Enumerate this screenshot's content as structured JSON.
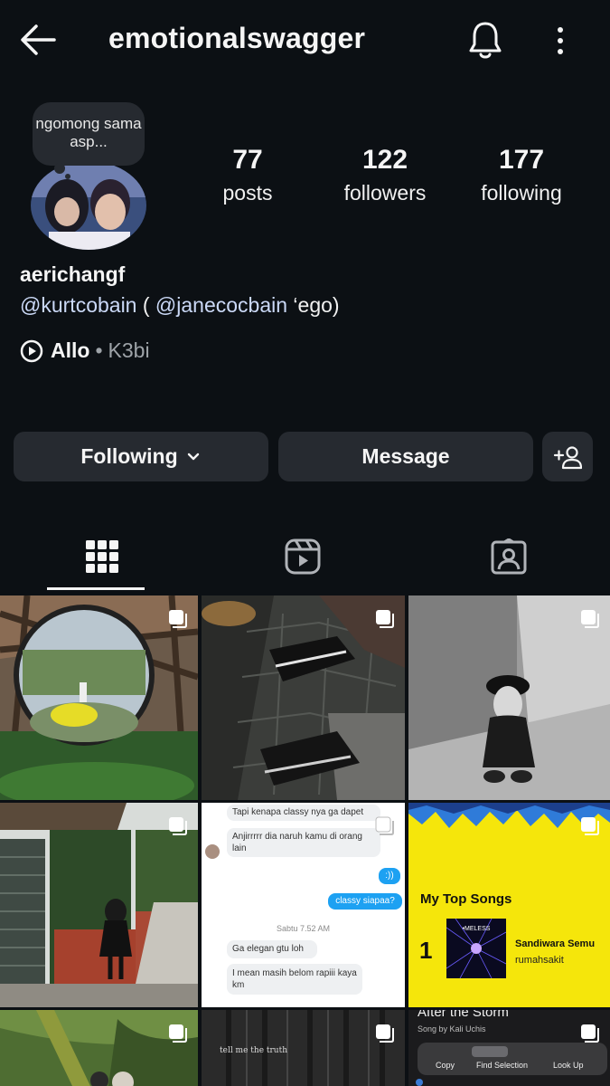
{
  "header": {
    "title": "emotionalswagger"
  },
  "profile": {
    "note": "ngomong sama asp...",
    "stats": {
      "posts": {
        "value": "77",
        "label": "posts"
      },
      "followers": {
        "value": "122",
        "label": "followers"
      },
      "following": {
        "value": "177",
        "label": "following"
      }
    },
    "name": "aerichangf",
    "bio": {
      "mention1": "@kurtcobain",
      "mid": " ( ",
      "mention2": "@janecocbain",
      "tail": " ‘ego)"
    },
    "music": {
      "song": "Allo",
      "sep": "•",
      "artist": "K3bi"
    }
  },
  "actions": {
    "following_label": "Following",
    "message_label": "Message"
  },
  "tabs": [
    "grid-tab",
    "reels-tab",
    "tagged-tab"
  ],
  "posts": {
    "chat": {
      "lines": [
        "Tapi kenapa classy nya ga dapet",
        "Anjirrrrr dia naruh kamu di orang lain",
        ":))",
        "classy siapaa?",
        "Sabtu 7.52 AM",
        "Ga elegan gtu loh",
        "I mean masih belom rapiii kaya km"
      ]
    },
    "spotify": {
      "heading": "My Top Songs",
      "rank": "1",
      "cover_text": "•MELESS",
      "song": "Sandiwara Semu",
      "artist": "rumahsakit"
    },
    "forest_text": "tell me the truth",
    "storm": {
      "title": "After the Storm",
      "subtitle": "Song by Kali Uchis",
      "menu": [
        "Copy",
        "Find Selection",
        "Look Up"
      ]
    }
  },
  "colors": {
    "background": "#0c1014",
    "button": "#262a30",
    "mention": "#cbd9f7",
    "spotify_yellow": "#f5e60b"
  }
}
